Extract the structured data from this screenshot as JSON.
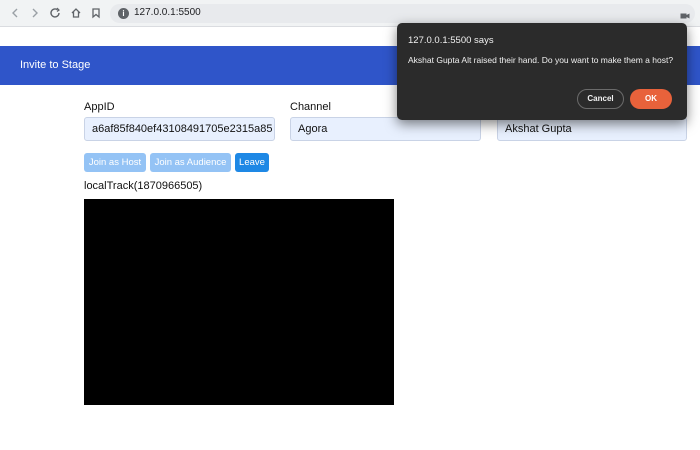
{
  "browser": {
    "url": "127.0.0.1:5500",
    "nav_icons": [
      "back-icon",
      "forward-icon",
      "reload-icon",
      "home-icon",
      "bookmark-icon"
    ]
  },
  "appbar": {
    "title": "Invite to Stage"
  },
  "form": {
    "appid_label": "AppID",
    "appid_value": "a6af85f840ef43108491705e2315a85",
    "channel_label": "Channel",
    "channel_value": "Agora",
    "username_value": "Akshat Gupta"
  },
  "buttons": {
    "join_host": "Join as Host",
    "join_audience": "Join as Audience",
    "leave": "Leave"
  },
  "local_track": {
    "label": "localTrack(1870966505)"
  },
  "dialog": {
    "title": "127.0.0.1:5500 says",
    "message": "Akshat Gupta Alt raised their hand. Do you want to make them a host?",
    "cancel": "Cancel",
    "ok": "OK"
  },
  "colors": {
    "appbar": "#2f55c9",
    "button_light": "#94c3f5",
    "button_leave": "#1e88e5",
    "dialog_ok": "#e8623b"
  }
}
